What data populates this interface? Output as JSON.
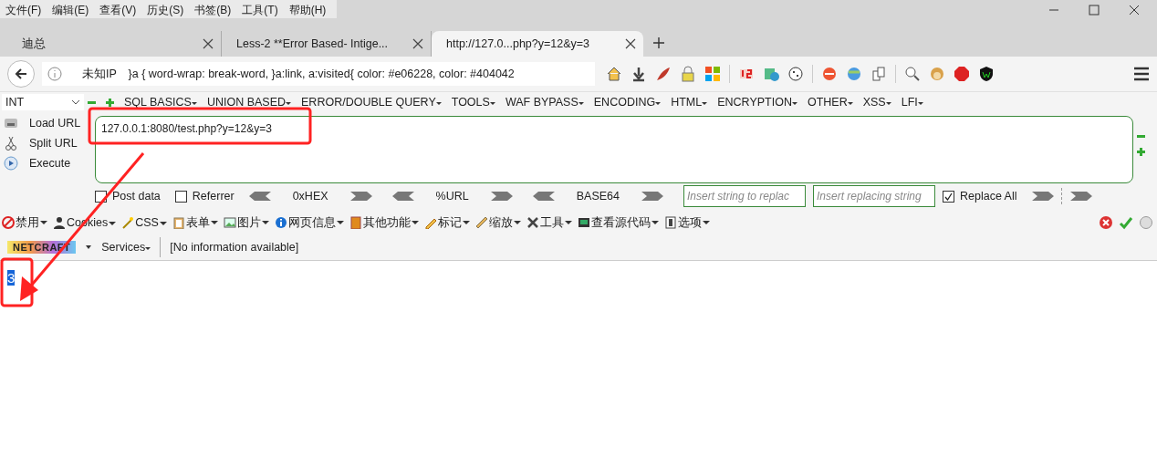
{
  "menu_bar": [
    "文件(F)",
    "编辑(E)",
    "查看(V)",
    "历史(S)",
    "书签(B)",
    "工具(T)",
    "帮助(H)"
  ],
  "tabs": [
    {
      "label": "迪总",
      "selected": false
    },
    {
      "label": "Less-2 **Error Based- Intige...",
      "selected": false
    },
    {
      "label": "http://127.0...php?y=12&y=3",
      "selected": true
    }
  ],
  "address_bar": {
    "text": "未知IP　}a { word-wrap: break-word, }a:link, a:visited{ color: #e06228, color: #404042"
  },
  "hackbar": {
    "select": "INT",
    "menus": [
      "SQL BASICS",
      "UNION BASED",
      "ERROR/DOUBLE QUERY",
      "TOOLS",
      "WAF BYPASS",
      "ENCODING",
      "HTML",
      "ENCRYPTION",
      "OTHER",
      "XSS",
      "LFI"
    ],
    "actions": [
      "Load URL",
      "Split URL",
      "Execute"
    ],
    "url": "127.0.0.1:8080/test.php?y=12&y=3",
    "options": [
      {
        "kind": "checkbox",
        "label": "Post data",
        "checked": false
      },
      {
        "kind": "checkbox",
        "label": "Referrer",
        "checked": false
      },
      {
        "kind": "encoder",
        "label": "0xHEX"
      },
      {
        "kind": "encoder",
        "label": "%URL"
      },
      {
        "kind": "encoder",
        "label": "BASE64"
      },
      {
        "kind": "field",
        "placeholder": "Insert string to replac"
      },
      {
        "kind": "field",
        "placeholder": "Insert replacing string"
      },
      {
        "kind": "checkbox",
        "label": "Replace All",
        "checked": true
      }
    ]
  },
  "dev_toolbar": [
    "禁用",
    "Cookies",
    "CSS",
    "表单",
    "图片",
    "网页信息",
    "其他功能",
    "标记",
    "缩放",
    "工具",
    "查看源代码",
    "选项"
  ],
  "netcraft_bar": {
    "logo": "NETCRAFT",
    "services": "Services",
    "info": "[No information available]"
  },
  "page": {
    "text": "3",
    "selected": true
  }
}
